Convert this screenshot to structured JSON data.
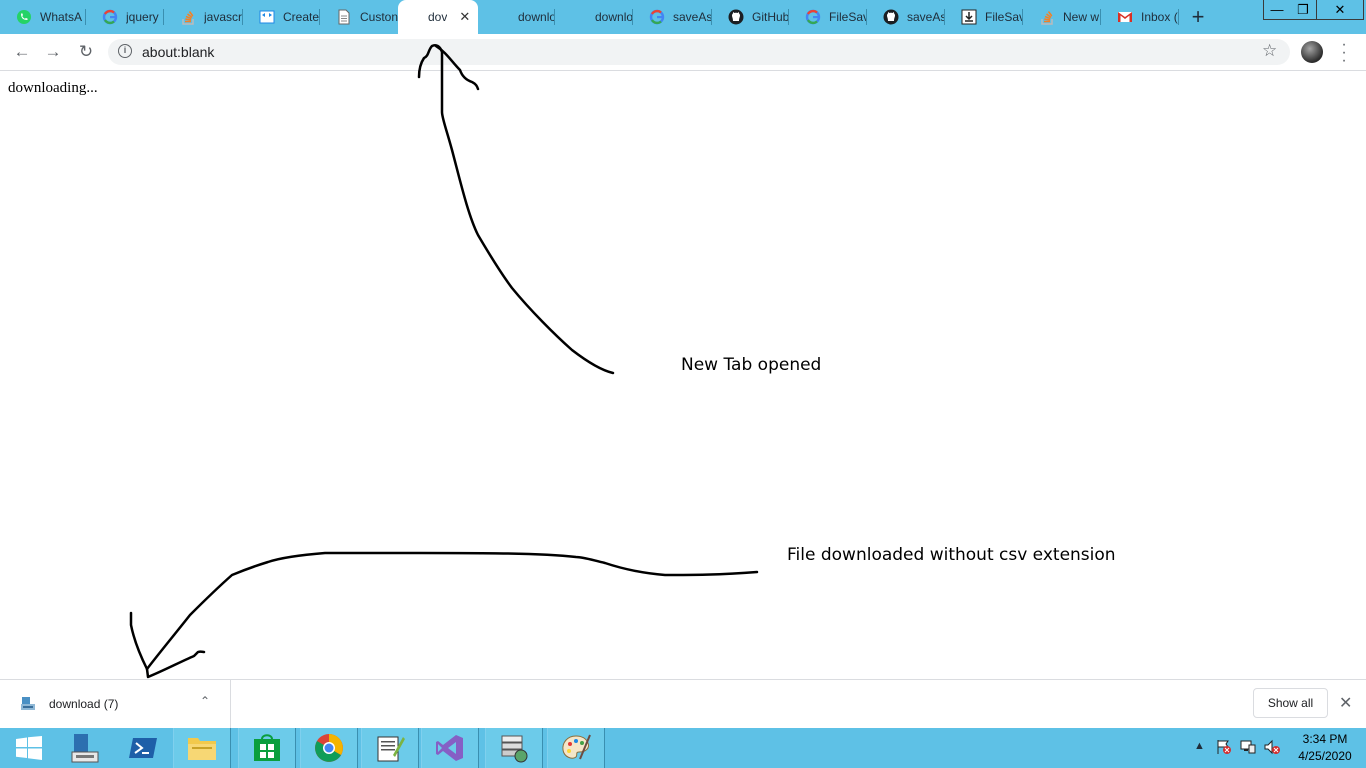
{
  "tabs": [
    {
      "title": "WhatsA",
      "icon": "whatsapp-icon"
    },
    {
      "title": "jquery",
      "icon": "google-icon"
    },
    {
      "title": "javascr",
      "icon": "stackoverflow-icon"
    },
    {
      "title": "Create",
      "icon": "codepen-icon"
    },
    {
      "title": "Custon",
      "icon": "document-icon"
    },
    {
      "title": "dov",
      "icon": "",
      "active": true
    },
    {
      "title": "downlo",
      "icon": ""
    },
    {
      "title": "downlo",
      "icon": ""
    },
    {
      "title": "saveAs",
      "icon": "google-icon"
    },
    {
      "title": "GitHub",
      "icon": "github-icon"
    },
    {
      "title": "FileSav",
      "icon": "google-icon"
    },
    {
      "title": "saveAs",
      "icon": "github-icon"
    },
    {
      "title": "FileSav",
      "icon": "download-box-icon"
    },
    {
      "title": "New w",
      "icon": "stackoverflow-icon"
    },
    {
      "title": "Inbox (",
      "icon": "gmail-icon"
    }
  ],
  "toolbar": {
    "url": "about:blank"
  },
  "content": {
    "body_text": "downloading..."
  },
  "annotations": {
    "new_tab": "New Tab opened",
    "file_downloaded": "File downloaded without csv extension"
  },
  "download_bar": {
    "file_name": "download (7)",
    "show_all": "Show all"
  },
  "taskbar": {
    "time": "3:34 PM",
    "date": "4/25/2020"
  },
  "colors": {
    "chrome_frame": "#5ec1e6",
    "active_tab": "#ffffff",
    "taskbar": "#5ec1e6"
  }
}
